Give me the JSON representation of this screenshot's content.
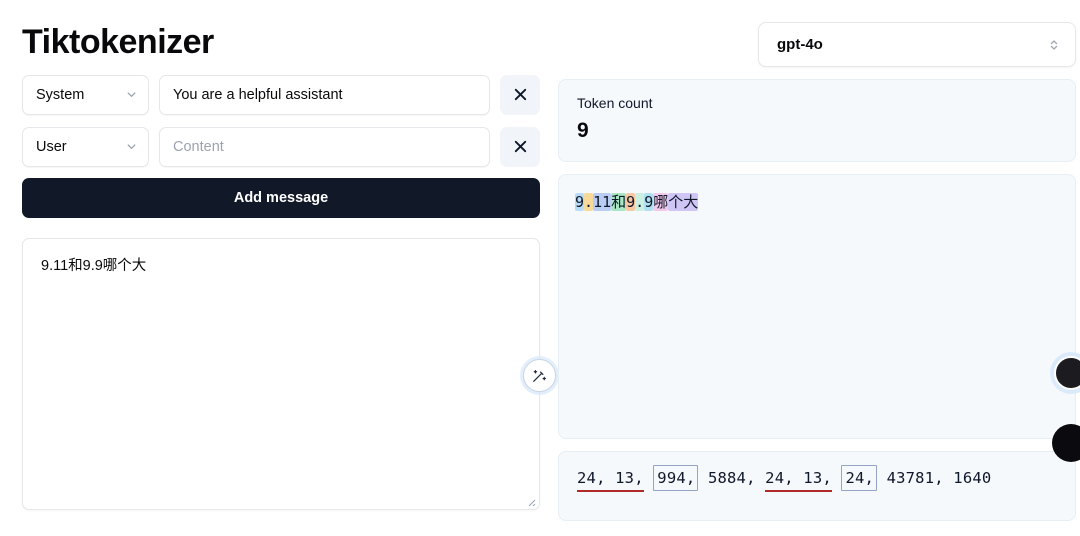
{
  "app": {
    "title": "Tiktokenizer"
  },
  "model_selector": {
    "value": "gpt-4o",
    "icon": "chevron-up-down-icon"
  },
  "messages": [
    {
      "role": "System",
      "role_icon": "chevron-down-icon",
      "content": "You are a helpful assistant",
      "placeholder": "Content",
      "remove_icon": "close-icon"
    },
    {
      "role": "User",
      "role_icon": "chevron-down-icon",
      "content": "",
      "placeholder": "Content",
      "remove_icon": "close-icon"
    }
  ],
  "add_message_button": {
    "label": "Add message"
  },
  "textarea": {
    "value": "9.11和9.9哪个大",
    "placeholder": ""
  },
  "magic_button": {
    "icon": "magic-wand-icon"
  },
  "token_count": {
    "label": "Token count",
    "value": "9"
  },
  "tokenized_text": {
    "tokens": [
      {
        "text": "9",
        "color": "#b9dcf5"
      },
      {
        "text": ".",
        "color": "#f7d99a"
      },
      {
        "text": "11",
        "color": "#b9cdf2"
      },
      {
        "text": "和",
        "color": "#a9e6c3"
      },
      {
        "text": "9",
        "color": "#f6c7a0"
      },
      {
        "text": ".",
        "color": "#c9f0e0"
      },
      {
        "text": "9",
        "color": "#aee0f0"
      },
      {
        "text": "哪",
        "color": "#f2c9ea"
      },
      {
        "text": "个大",
        "color": "#cfc6f5"
      }
    ]
  },
  "token_ids": {
    "segments": [
      {
        "text": "24, 13,",
        "style": "underline-red"
      },
      {
        "text": " ",
        "style": "plain"
      },
      {
        "text": "994,",
        "style": "boxed"
      },
      {
        "text": " 5884, ",
        "style": "plain"
      },
      {
        "text": "24, 13,",
        "style": "underline-red"
      },
      {
        "text": " ",
        "style": "plain"
      },
      {
        "text": "24,",
        "style": "boxed"
      },
      {
        "text": " 43781, 1640",
        "style": "plain"
      }
    ],
    "plain_text": "24, 13, 994, 5884, 24, 13, 24, 43781, 1640",
    "values": [
      24,
      13,
      994,
      5884,
      24,
      13,
      24,
      43781,
      1640
    ]
  },
  "edge_buttons": [
    {
      "name": "avatar-bubble"
    },
    {
      "name": "dark-circle-button"
    }
  ]
}
